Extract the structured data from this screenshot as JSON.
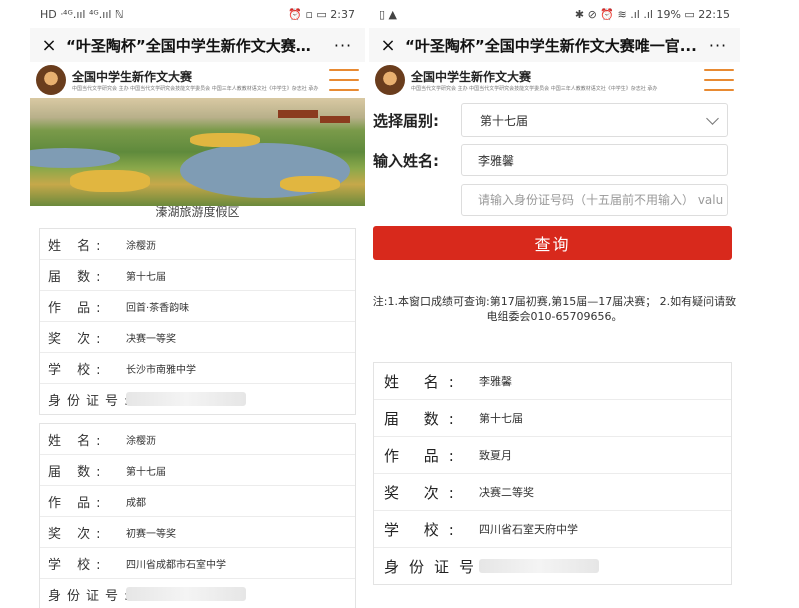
{
  "left": {
    "status": {
      "left": "HD ᐧ⁴ᴳ.ııl ⁴ᴳ.ııl ℕ",
      "right": "⏰ ▫ ▭ 2:37"
    },
    "title": "“叶圣陶杯”全国中学生新作文大赛唯一...",
    "more": "···",
    "close": "×",
    "logo": {
      "main": "全国中学生新作文大赛",
      "sub": "中国当代文学研究会 主办  中国当代文学研究会技能文学委员会 中国三年人教教材语文社《中学生》杂志社  承办"
    },
    "banner_caption": "溱湖旅游度假区",
    "cards": [
      {
        "rows": [
          {
            "label": "姓 名:",
            "value": "涂樱沥"
          },
          {
            "label": "届 数:",
            "value": "第十七届"
          },
          {
            "label": "作 品:",
            "value": "回首·茶香韵味"
          },
          {
            "label": "奖 次:",
            "value": "决赛一等奖"
          },
          {
            "label": "学 校:",
            "value": "长沙市南雅中学"
          },
          {
            "label": "身份证号:",
            "value": ""
          }
        ]
      },
      {
        "rows": [
          {
            "label": "姓 名:",
            "value": "涂樱沥"
          },
          {
            "label": "届 数:",
            "value": "第十七届"
          },
          {
            "label": "作 品:",
            "value": "成都"
          },
          {
            "label": "奖 次:",
            "value": "初赛一等奖"
          },
          {
            "label": "学 校:",
            "value": "四川省成都市石室中学"
          },
          {
            "label": "身份证号:",
            "value": ""
          }
        ]
      }
    ]
  },
  "right": {
    "status": {
      "left": "▯ ▲",
      "right": "✱ ⊘ ⏰ ≋ .ıl .ıl 19% ▭ 22:15"
    },
    "title": "“叶圣陶杯”全国中学生新作文大赛唯一官...",
    "more": "···",
    "close": "×",
    "logo": {
      "main": "全国中学生新作文大赛",
      "sub": "中国当代文学研究会 主办  中国当代文学研究会技能文学委员会 中国三年人教教材语文社《中学生》杂志社  承办"
    },
    "form": {
      "session_label": "选择届别:",
      "session_value": "第十七届",
      "name_label": "输入姓名:",
      "name_value": "李雅馨",
      "id_placeholder": "请输入身份证号码（十五届前不用输入） valu",
      "query_button": "查询"
    },
    "note": "注:1.本窗口成绩可查询:第17届初赛,第15届—17届决赛； 2.如有疑问请致电组委会010-65709656。",
    "result": [
      {
        "label": "姓 名:",
        "value": "李雅馨"
      },
      {
        "label": "届 数:",
        "value": "第十七届"
      },
      {
        "label": "作 品:",
        "value": "致夏月"
      },
      {
        "label": "奖 次:",
        "value": "决赛二等奖"
      },
      {
        "label": "学 校:",
        "value": "四川省石室天府中学"
      },
      {
        "label": "身份证号:",
        "value": ""
      }
    ]
  }
}
